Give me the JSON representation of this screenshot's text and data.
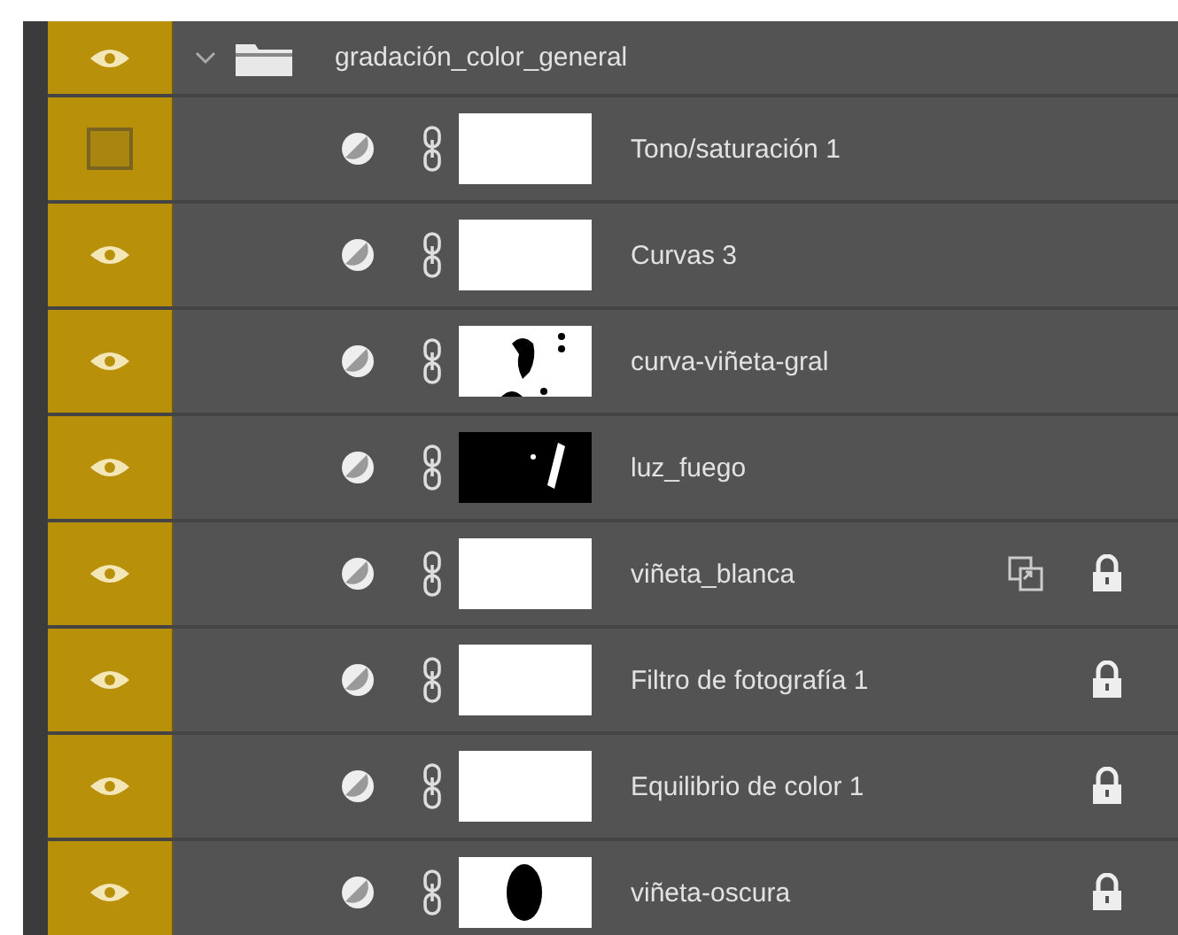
{
  "group": {
    "name": "gradación_color_general",
    "visible": true,
    "expanded": true
  },
  "layers": [
    {
      "name": "Tono/saturación 1",
      "visible": false,
      "kind": "white",
      "linked_icon": false,
      "locked": false
    },
    {
      "name": "Curvas 3",
      "visible": true,
      "kind": "white",
      "linked_icon": false,
      "locked": false
    },
    {
      "name": "curva-viñeta-gral",
      "visible": true,
      "kind": "spots",
      "linked_icon": false,
      "locked": false
    },
    {
      "name": "luz_fuego",
      "visible": true,
      "kind": "dark",
      "linked_icon": false,
      "locked": false
    },
    {
      "name": "viñeta_blanca",
      "visible": true,
      "kind": "white",
      "linked_icon": true,
      "locked": true
    },
    {
      "name": "Filtro de fotografía 1",
      "visible": true,
      "kind": "white",
      "linked_icon": false,
      "locked": true
    },
    {
      "name": "Equilibrio de color 1",
      "visible": true,
      "kind": "white",
      "linked_icon": false,
      "locked": true
    },
    {
      "name": "viñeta-oscura",
      "visible": true,
      "kind": "figure",
      "linked_icon": false,
      "locked": true
    }
  ]
}
